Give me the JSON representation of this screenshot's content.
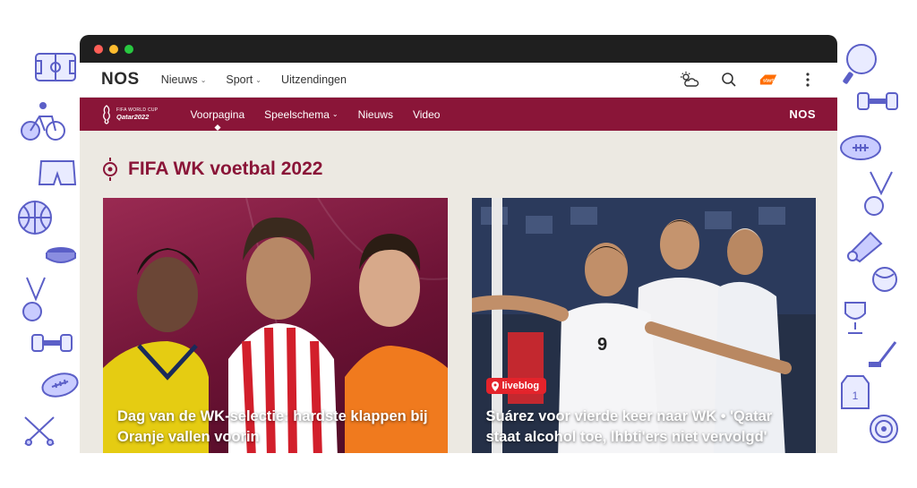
{
  "window": {
    "dots": [
      "#ff5f57",
      "#febc2e",
      "#28c840"
    ]
  },
  "header": {
    "logo": "NOS",
    "nav": [
      {
        "label": "Nieuws",
        "dropdown": true
      },
      {
        "label": "Sport",
        "dropdown": true
      },
      {
        "label": "Uitzendingen",
        "dropdown": false
      }
    ],
    "icons": [
      "weather-icon",
      "search-icon",
      "npo-start-icon",
      "more-icon"
    ]
  },
  "wk_bar": {
    "logo_line1": "FIFA WORLD CUP",
    "logo_line2": "Qatar2022",
    "nav": [
      {
        "label": "Voorpagina",
        "active": true
      },
      {
        "label": "Speelschema",
        "dropdown": true
      },
      {
        "label": "Nieuws"
      },
      {
        "label": "Video"
      }
    ],
    "right_logo": "NOS",
    "color": "#8a1538"
  },
  "section": {
    "title": "FIFA WK voetbal 2022"
  },
  "cards": [
    {
      "title": "Dag van de WK-selectie: hardste klappen bij Oranje vallen voorin"
    },
    {
      "badge": "liveblog",
      "title": "Suárez voor vierde keer naar WK • 'Qatar staat alcohol toe, lhbti'ers niet vervolgd'"
    }
  ]
}
